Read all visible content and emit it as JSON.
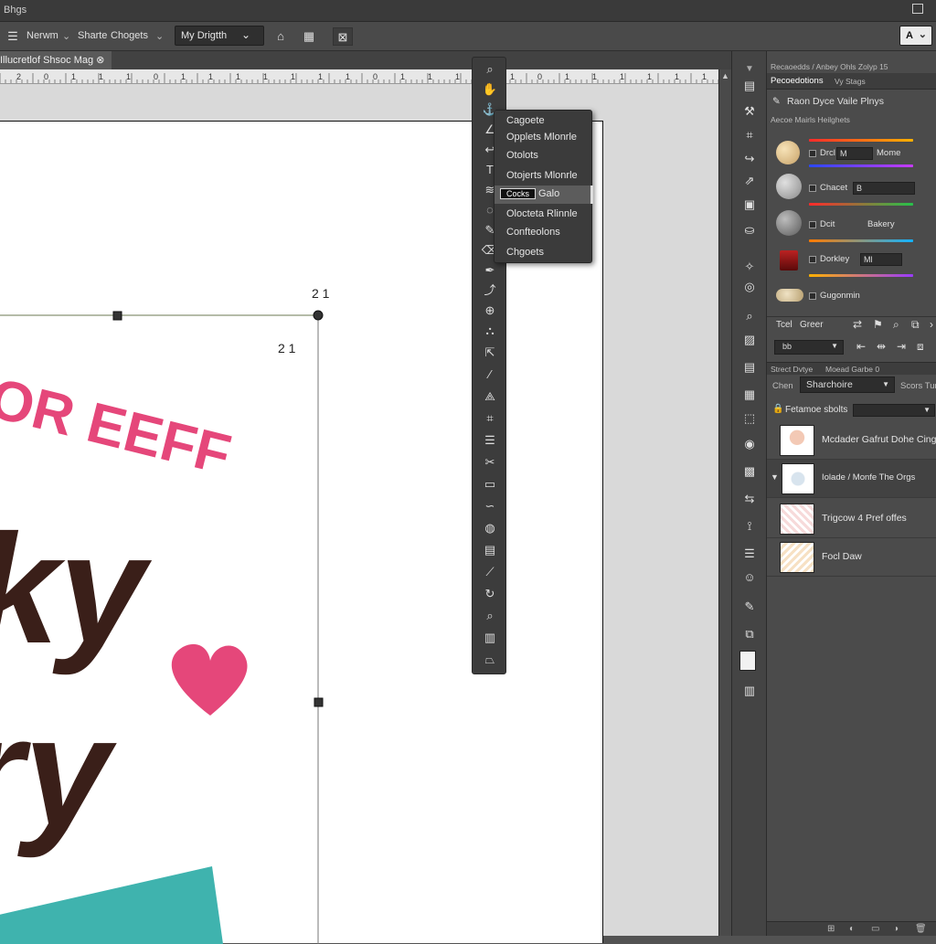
{
  "window": {
    "title": "Bhgs"
  },
  "options_bar": {
    "items": [
      "Nerwm",
      "Sharte",
      "Chogets"
    ],
    "font_dropdown": "My Drigtth",
    "right_dropdown": "A"
  },
  "document": {
    "tab_label": "Illucretlof Shsoc Mag",
    "ruler_numbers": [
      "2",
      "0",
      "1",
      "1",
      "1",
      "0",
      "1",
      "1",
      "1",
      "1",
      "1",
      "1",
      "1",
      "0",
      "1",
      "1",
      "1",
      "1",
      "1",
      "0",
      "1",
      "1",
      "1",
      "1",
      "1",
      "1"
    ],
    "dim_label_1": "2 1",
    "dim_label_2": "2 1",
    "artwork": {
      "line1": "OR EEFF",
      "line2": "ky",
      "line3": "ry",
      "colors": {
        "pink": "#e5477a",
        "brown": "#3a1f19",
        "teal": "#3fb3ae"
      }
    }
  },
  "tool_flyout": {
    "items": [
      "Cagoete",
      "Opplets Mlonrle",
      "Otolots",
      "Otojerts Mlonrle",
      "Cocks",
      "Olocteta Rlinnle",
      "Confteolons",
      "Chgoets"
    ],
    "selected_index": 4,
    "selected_tag": "Cocks"
  },
  "panel": {
    "header_small": "Recaoedds / Anbey Ohls Zolyp 15",
    "tab_active": "Pecoedotions",
    "tab_inactive": "Vy Stags",
    "tools_row": "Raon  Dyce  Vaile Plnys",
    "section_label": "Aecoe Mairls Heilghets",
    "swatches": [
      {
        "label": "Drcl",
        "field": "M",
        "right": "Mome"
      },
      {
        "label": "Chacet",
        "field": "B",
        "right": ""
      },
      {
        "label": "Dcit",
        "field": "",
        "right": "Bakery"
      },
      {
        "label": "Dorkley",
        "field": "Ml",
        "right": ""
      },
      {
        "label": "Gugonmin",
        "field": "",
        "right": ""
      }
    ],
    "icon_row_label_1": "Tcel",
    "icon_row_label_2": "Greer",
    "blend_mode": "bb",
    "layers_tab_1": "Strect Dvtye",
    "layers_tab_2": "Moead Garbe 0",
    "layers_mode_label": "Chen",
    "layers_mode_value": "Sharchoire",
    "layers_mode_right": "Scors  Tur",
    "fill_label": "Fetamoe sbolts",
    "layers": [
      "Mcdader Gafrut Dohe Cingin",
      "Iolade / Monfe The Orgs",
      "Trigcow 4 Pref offes",
      "Focl Daw"
    ]
  }
}
